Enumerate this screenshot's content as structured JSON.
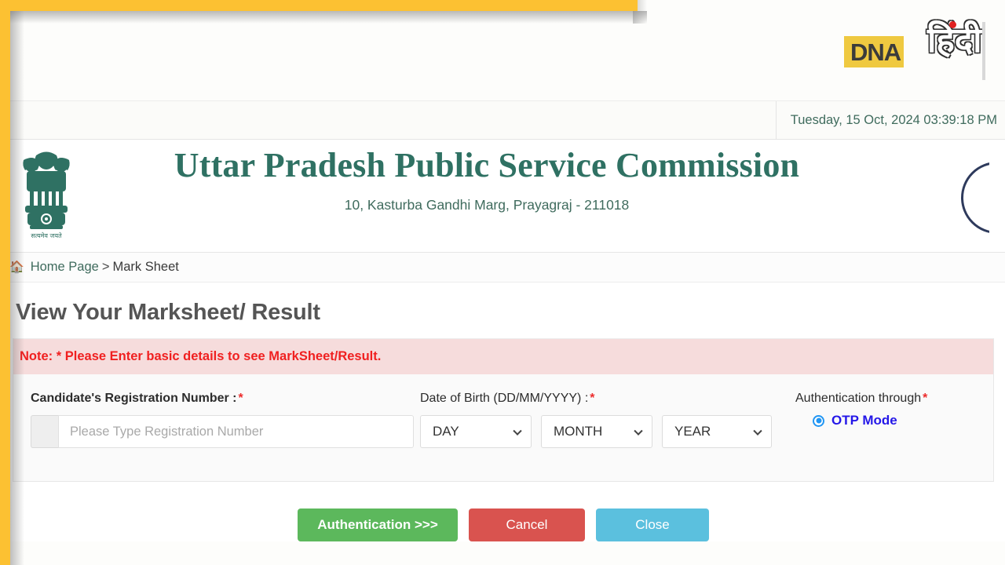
{
  "brand": {
    "logo_text": "DNA",
    "logo_text_hindi": "हिंदी",
    "logo_name": "dna-hindi-logo"
  },
  "datetime": {
    "value": "Tuesday, 15 Oct, 2024 03:39:18 PM"
  },
  "org": {
    "emblem_name": "state-emblem-of-india",
    "name": "Uttar Pradesh Public Service Commission",
    "address": "10, Kasturba Gandhi Marg, Prayagraj - 211018"
  },
  "breadcrumb": {
    "home_icon": "home-icon",
    "home_label": "Home Page",
    "separator": ">",
    "current": "Mark Sheet"
  },
  "page": {
    "title": "View Your Marksheet/ Result",
    "note": "Note: * Please Enter basic details to see MarkSheet/Result."
  },
  "form": {
    "registration": {
      "label": "Candidate's Registration Number :",
      "required_mark": "*",
      "value": "",
      "placeholder": "Please Type Registration Number"
    },
    "dob": {
      "label": "Date of Birth (DD/MM/YYYY) :",
      "required_mark": "*",
      "day": "DAY",
      "month": "MONTH",
      "year": "YEAR"
    },
    "auth": {
      "label": "Authentication through",
      "required_mark": "*",
      "option_label": "OTP Mode",
      "selected": true
    }
  },
  "actions": {
    "authentication": "Authentication >>>",
    "cancel": "Cancel",
    "close": "Close"
  },
  "colors": {
    "accent_yellow": "#fcc132",
    "org_green": "#2f7163",
    "note_red": "#f02020",
    "otp_blue": "#2417e8",
    "btn_green": "#5cb85c",
    "btn_red": "#d9534f",
    "btn_blue": "#5bc0de"
  }
}
